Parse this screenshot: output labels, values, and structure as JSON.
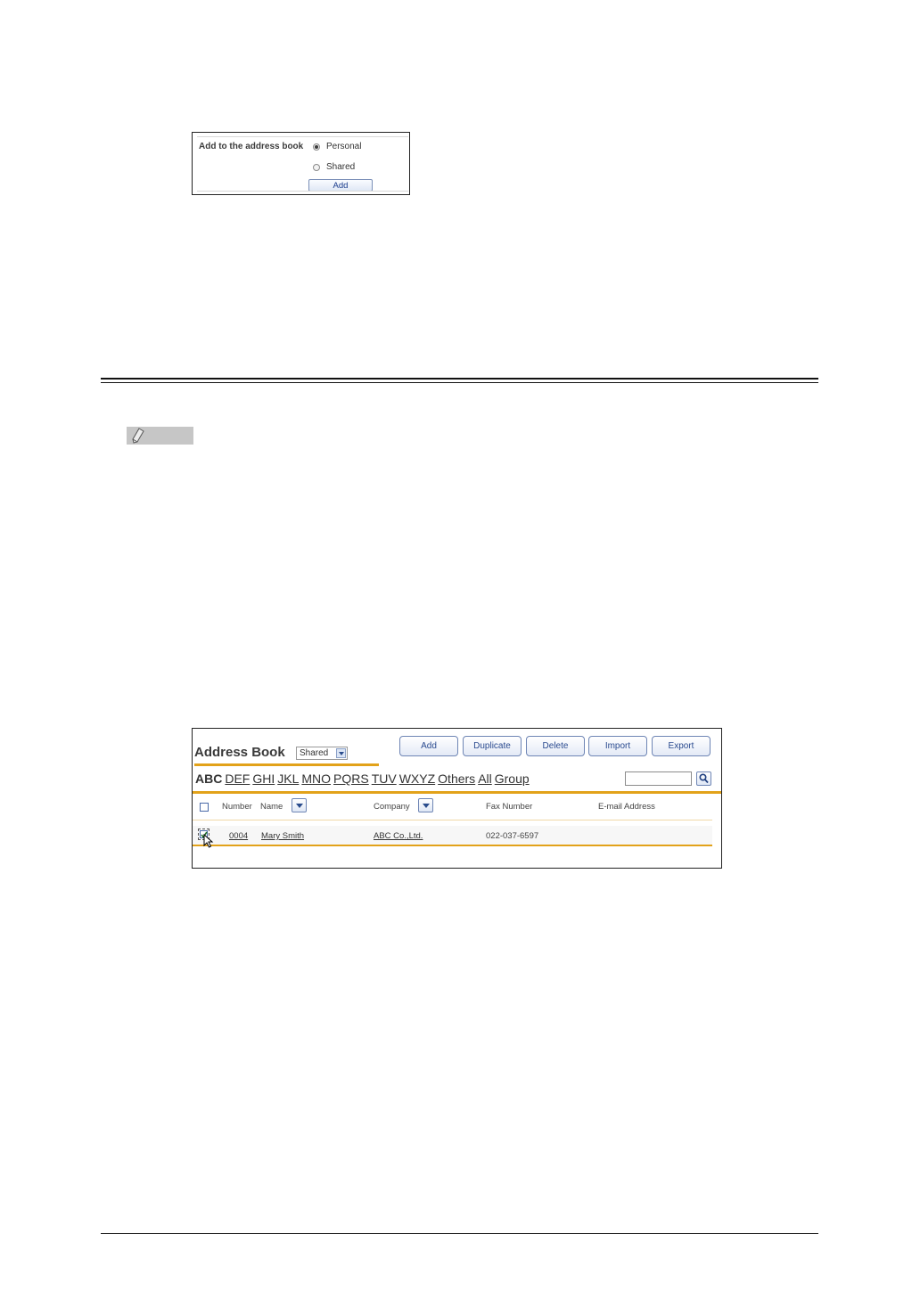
{
  "add_panel": {
    "label": "Add to the address book",
    "options": [
      {
        "label": "Personal",
        "selected": true
      },
      {
        "label": "Shared",
        "selected": false
      }
    ],
    "add_button": "Add"
  },
  "address_book": {
    "title": "Address Book",
    "book_select": "Shared",
    "toolbar": {
      "add": "Add",
      "duplicate": "Duplicate",
      "delete": "Delete",
      "import": "Import",
      "export": "Export"
    },
    "index_tabs": [
      "ABC",
      "DEF",
      "GHI",
      "JKL",
      "MNO",
      "PQRS",
      "TUV",
      "WXYZ",
      "Others",
      "All",
      "Group"
    ],
    "current_tab": "ABC",
    "search_value": "",
    "columns": {
      "number": "Number",
      "name": "Name",
      "company": "Company",
      "fax": "Fax Number",
      "email": "E-mail Address"
    },
    "rows": [
      {
        "number": "0004",
        "name": "Mary Smith",
        "company": "ABC Co.,Ltd.",
        "fax": "022-037-6597",
        "email": "",
        "checked": true
      }
    ],
    "accent_color": "#e2a21a"
  }
}
